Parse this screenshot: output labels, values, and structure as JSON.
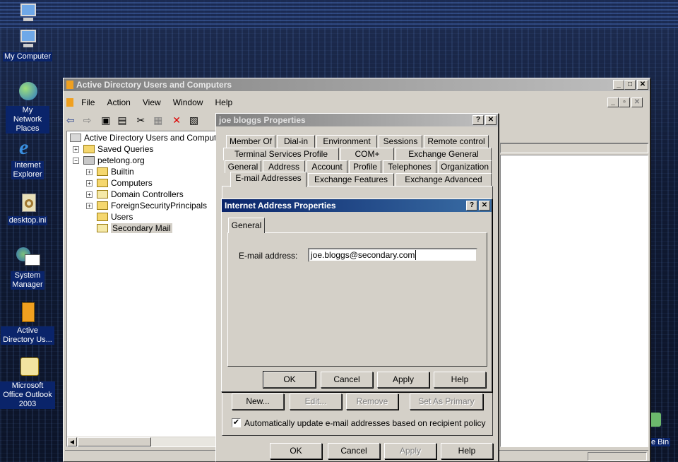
{
  "desktop": {
    "icons": [
      {
        "label": "My Computer"
      },
      {
        "label": "My Network Places"
      },
      {
        "label": "Internet Explorer"
      },
      {
        "label": "desktop.ini"
      },
      {
        "label": "System Manager"
      },
      {
        "label": "Active Directory Us..."
      },
      {
        "label": "Microsoft Office Outlook 2003"
      }
    ],
    "recycle_fragment": "e Bin"
  },
  "mmc": {
    "title": "Active Directory Users and Computers",
    "menu": [
      "File",
      "Action",
      "View",
      "Window",
      "Help"
    ],
    "tree": {
      "root": "Active Directory Users and Computers",
      "saved": "Saved Queries",
      "domain": "petelong.org",
      "children": [
        "Builtin",
        "Computers",
        "Domain Controllers",
        "ForeignSecurityPrincipals",
        "Users",
        "Secondary Mail"
      ]
    }
  },
  "props": {
    "title": "joe bloggs Properties",
    "tabs_row1": [
      "Member Of",
      "Dial-in",
      "Environment",
      "Sessions",
      "Remote control"
    ],
    "tabs_row2": [
      "Terminal Services Profile",
      "COM+",
      "Exchange General"
    ],
    "tabs_row3": [
      "General",
      "Address",
      "Account",
      "Profile",
      "Telephones",
      "Organization"
    ],
    "tabs_row4": [
      "E-mail Addresses",
      "Exchange Features",
      "Exchange Advanced"
    ],
    "buttons": {
      "new": "New...",
      "edit": "Edit...",
      "remove": "Remove",
      "primary": "Set As Primary"
    },
    "auto_update": "Automatically update e-mail addresses based on recipient policy",
    "auto_checked": true,
    "footer": {
      "ok": "OK",
      "cancel": "Cancel",
      "apply": "Apply",
      "help": "Help"
    }
  },
  "iap": {
    "title": "Internet Address Properties",
    "tab": "General",
    "label": "E-mail address:",
    "value": "joe.bloggs@secondary.com",
    "buttons": {
      "ok": "OK",
      "cancel": "Cancel",
      "apply": "Apply",
      "help": "Help"
    }
  }
}
